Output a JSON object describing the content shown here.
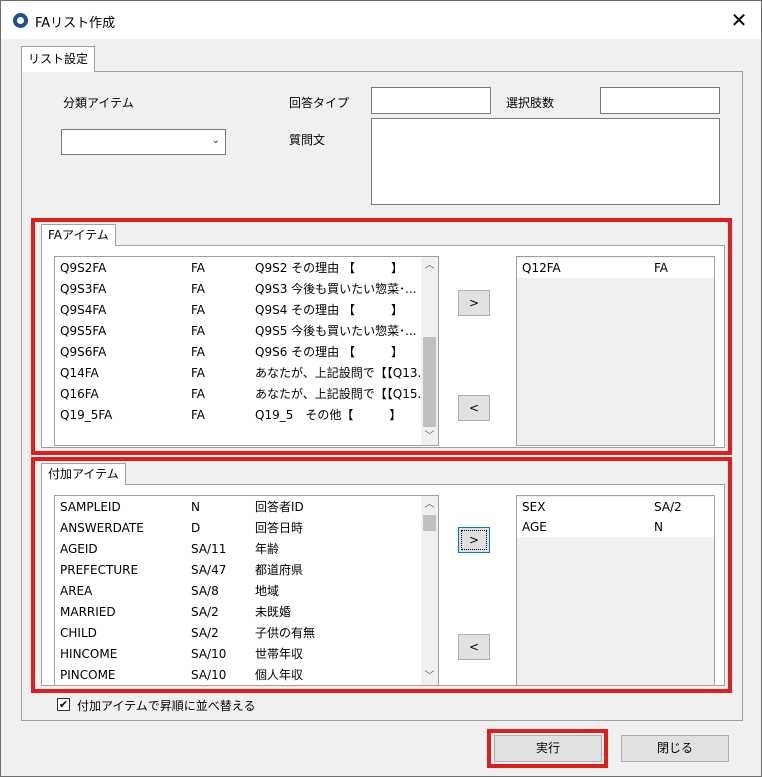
{
  "window": {
    "title": "FAリスト作成",
    "close_glyph": "✕"
  },
  "tabs": {
    "list_settings": "リスト設定",
    "fa_items": "FAアイテム",
    "additional_items": "付加アイテム"
  },
  "form": {
    "category_item_label": "分類アイテム",
    "category_item_value": "",
    "answer_type_label": "回答タイプ",
    "answer_type_value": "",
    "choice_count_label": "選択肢数",
    "choice_count_value": "",
    "question_text_label": "質問文",
    "question_text_value": ""
  },
  "fa_list": {
    "rows": [
      {
        "id": "Q9S2FA",
        "type": "FA",
        "text": "Q9S2 その理由 【　　　】"
      },
      {
        "id": "Q9S3FA",
        "type": "FA",
        "text": "Q9S3 今後も買いたい惣菜･..."
      },
      {
        "id": "Q9S4FA",
        "type": "FA",
        "text": "Q9S4 その理由 【　　　】"
      },
      {
        "id": "Q9S5FA",
        "type": "FA",
        "text": "Q9S5 今後も買いたい惣菜･..."
      },
      {
        "id": "Q9S6FA",
        "type": "FA",
        "text": "Q9S6 その理由 【　　　】"
      },
      {
        "id": "Q14FA",
        "type": "FA",
        "text": "あなたが、上記設問で【【Q13..."
      },
      {
        "id": "Q16FA",
        "type": "FA",
        "text": "あなたが、上記設問で【【Q15..."
      },
      {
        "id": "Q19_5FA",
        "type": "FA",
        "text": "Q19_5　その他【　　　】"
      }
    ],
    "scroll_fraction": 0.55
  },
  "fa_selected": {
    "rows": [
      {
        "id": "Q12FA",
        "type": "FA"
      }
    ]
  },
  "additional_list": {
    "rows": [
      {
        "id": "SAMPLEID",
        "type": "N",
        "text": "回答者ID"
      },
      {
        "id": "ANSWERDATE",
        "type": "D",
        "text": "回答日時"
      },
      {
        "id": "AGEID",
        "type": "SA/11",
        "text": "年齢"
      },
      {
        "id": "PREFECTURE",
        "type": "SA/47",
        "text": "都道府県"
      },
      {
        "id": "AREA",
        "type": "SA/8",
        "text": "地域"
      },
      {
        "id": "MARRIED",
        "type": "SA/2",
        "text": "未既婚"
      },
      {
        "id": "CHILD",
        "type": "SA/2",
        "text": "子供の有無"
      },
      {
        "id": "HINCOME",
        "type": "SA/10",
        "text": "世帯年収"
      },
      {
        "id": "PINCOME",
        "type": "SA/10",
        "text": "個人年収"
      }
    ],
    "scroll_fraction": 0.0
  },
  "additional_selected": {
    "rows": [
      {
        "id": "SEX",
        "type": "SA/2"
      },
      {
        "id": "AGE",
        "type": "N"
      }
    ]
  },
  "buttons": {
    "add": ">",
    "remove": "<",
    "execute": "実行",
    "close": "閉じる"
  },
  "sort_option": {
    "label": "付加アイテムで昇順に並べ替える",
    "checked": true,
    "check_glyph": "✔"
  },
  "icons": {
    "scroll_up": "︿",
    "scroll_down": "﹀",
    "dropdown": "⌄"
  },
  "colors": {
    "highlight": "#e01e1e",
    "focus": "#0078d7"
  }
}
